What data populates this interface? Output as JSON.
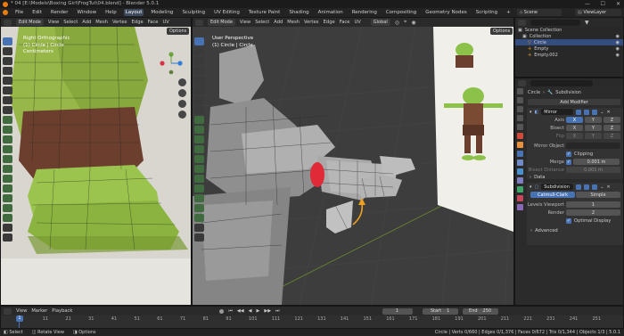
{
  "window": {
    "title": "* 04 [E:\\Models\\Boxing Girl\\FrogTut\\04.blend] - Blender 5.0.1"
  },
  "menubar": {
    "menus": [
      "File",
      "Edit",
      "Render",
      "Window",
      "Help"
    ],
    "workspaces": [
      "Layout",
      "Modeling",
      "Sculpting",
      "UV Editing",
      "Texture Paint",
      "Shading",
      "Animation",
      "Rendering",
      "Compositing",
      "Geometry Nodes",
      "Scripting"
    ],
    "active_workspace": "Layout",
    "scene": "Scene",
    "view_layer": "ViewLayer"
  },
  "viewport_left": {
    "mode": "Edit Mode",
    "menus": [
      "View",
      "Select",
      "Add",
      "Mesh",
      "Vertex",
      "Edge",
      "Face",
      "UV"
    ],
    "overlay_lines": [
      "Right Orthographic",
      "(1) Circle | Circle",
      "Centimeters"
    ],
    "options_label": "Options"
  },
  "viewport_right": {
    "mode": "Edit Mode",
    "menus": [
      "View",
      "Select",
      "Add",
      "Mesh",
      "Vertex",
      "Edge",
      "Face",
      "UV"
    ],
    "overlay_lines": [
      "User Perspective",
      "(1) Circle | Circle"
    ],
    "transform_orientation": "Global",
    "options_label": "Options"
  },
  "outliner": {
    "root": "Scene Collection",
    "items": [
      {
        "label": "Collection",
        "selected": false
      },
      {
        "label": "Circle",
        "selected": true
      },
      {
        "label": "Empty",
        "selected": false
      },
      {
        "label": "Empty.002",
        "selected": false
      }
    ]
  },
  "properties": {
    "breadcrumb": [
      "Circle",
      "Subdivision"
    ],
    "add_modifier_label": "Add Modifier",
    "mirror": {
      "name": "Mirror",
      "axis_label": "Axis",
      "bisect_label": "Bisect",
      "flip_label": "Flip",
      "axes": [
        "X",
        "Y",
        "Z"
      ],
      "mirror_object_label": "Mirror Object",
      "clipping_label": "Clipping",
      "merge_label": "Merge",
      "merge_value": "0.001 m",
      "bisect_distance_label": "Bisect Distance",
      "bisect_distance_value": "0.001 m",
      "data_label": "Data"
    },
    "subdivision": {
      "name": "Subdivision",
      "catmull_label": "Catmull-Clark",
      "simple_label": "Simple",
      "levels_viewport_label": "Levels Viewport",
      "levels_viewport_value": "1",
      "render_label": "Render",
      "render_value": "2",
      "optimal_display_label": "Optimal Display",
      "advanced_label": "Advanced"
    }
  },
  "timeline": {
    "menus": [
      "View",
      "Marker",
      "Playback"
    ],
    "current_frame": "1",
    "start_label": "Start",
    "start_value": "1",
    "end_label": "End",
    "end_value": "250",
    "ticks": [
      "1",
      "11",
      "21",
      "31",
      "41",
      "51",
      "61",
      "71",
      "81",
      "91",
      "101",
      "111",
      "121",
      "131",
      "141",
      "151",
      "161",
      "171",
      "181",
      "191",
      "201",
      "211",
      "221",
      "231",
      "241",
      "251"
    ]
  },
  "statusbar": {
    "left": [
      "Select",
      "Rotate View",
      "Options"
    ],
    "right": "Circle | Verts 0/660 | Edges 0/1,376 | Faces 0/672 | Tris 0/1,344 | Objects 1/3 | 5.0.1"
  },
  "colors": {
    "accent": "#4772b3",
    "selected_row": "#334d80",
    "ring": "#e02a38",
    "arrow": "#f0a020",
    "frog_skin": "#8cc14a"
  }
}
